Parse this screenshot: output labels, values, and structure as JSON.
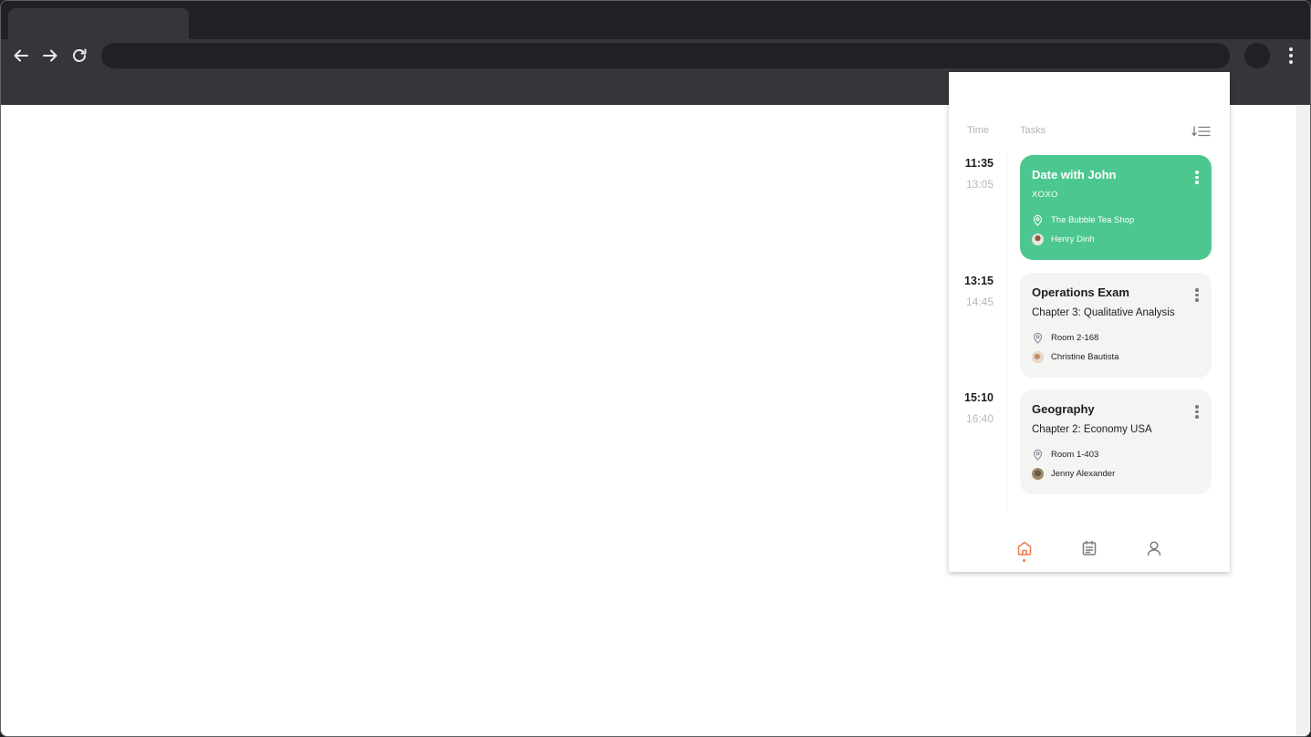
{
  "browser": {
    "icons": {
      "back": "arrow-left-icon",
      "forward": "arrow-right-icon",
      "reload": "reload-icon",
      "menu": "vertical-dots-icon"
    }
  },
  "schedule": {
    "headers": {
      "time": "Time",
      "tasks": "Tasks"
    },
    "items": [
      {
        "start": "11:35",
        "end": "13:05",
        "title": "Date with John",
        "subtitle": "XOXO",
        "location": "The Bubble Tea Shop",
        "person": "Henry Dinh",
        "style": "highlight",
        "color": "#4CC78F"
      },
      {
        "start": "13:15",
        "end": "14:45",
        "title": "Operations Exam",
        "subtitle": "Chapter 3: Qualitative Analysis",
        "location": "Room 2-168",
        "person": "Christine Bautista",
        "style": "default",
        "color": "#F4F4F2"
      },
      {
        "start": "15:10",
        "end": "16:40",
        "title": "Geography",
        "subtitle": "Chapter 2: Economy USA",
        "location": "Room 1-403",
        "person": "Jenny Alexander",
        "style": "default",
        "color": "#F4F4F2"
      }
    ],
    "bottom_nav": {
      "items": [
        "home-icon",
        "calendar-icon",
        "profile-icon"
      ],
      "active": "home-icon",
      "accent": "#EE7D4C"
    }
  }
}
